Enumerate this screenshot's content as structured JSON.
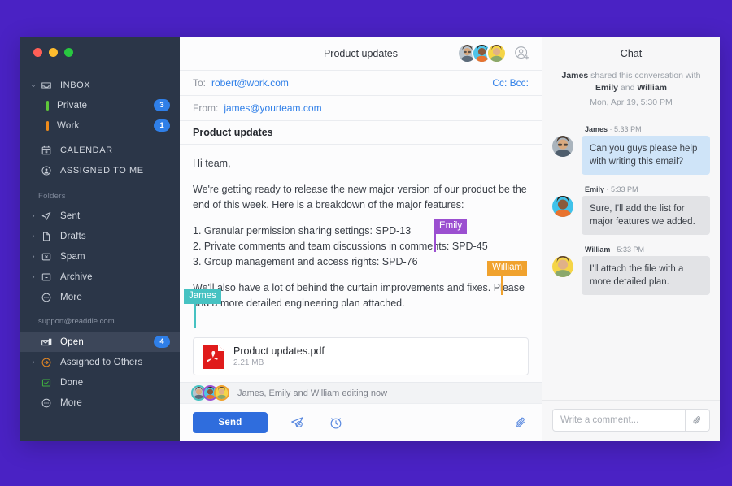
{
  "app": {
    "background_color": "#4a22c4"
  },
  "sidebar": {
    "traffic_lights": [
      "close",
      "minimize",
      "maximize"
    ],
    "inbox": {
      "label": "INBOX",
      "icon": "inbox-icon"
    },
    "inbox_children": [
      {
        "label": "Private",
        "badge": "3",
        "color": "#5fc73a"
      },
      {
        "label": "Work",
        "badge": "1",
        "color": "#ef8b1b"
      }
    ],
    "top_items": [
      {
        "label": "CALENDAR",
        "icon": "calendar-icon"
      },
      {
        "label": "ASSIGNED TO ME",
        "icon": "assigned-person-icon"
      }
    ],
    "folders_title": "Folders",
    "folders": [
      {
        "label": "Sent",
        "icon": "paper-plane-icon",
        "expandable": true
      },
      {
        "label": "Drafts",
        "icon": "document-icon",
        "expandable": true
      },
      {
        "label": "Spam",
        "icon": "spam-icon",
        "expandable": true
      },
      {
        "label": "Archive",
        "icon": "archive-box-icon",
        "expandable": true
      },
      {
        "label": "More",
        "icon": "ellipsis-circle-icon",
        "expandable": false
      }
    ],
    "account": "support@readdle.com",
    "account_items": [
      {
        "label": "Open",
        "icon": "open-envelope-icon",
        "badge": "4",
        "active": true,
        "expandable": false
      },
      {
        "label": "Assigned to Others",
        "icon": "assigned-others-icon",
        "badge": "",
        "active": false,
        "expandable": true
      },
      {
        "label": "Done",
        "icon": "done-check-icon",
        "badge": "",
        "active": false,
        "expandable": false
      },
      {
        "label": "More",
        "icon": "ellipsis-circle-icon",
        "badge": "",
        "active": false,
        "expandable": false
      }
    ]
  },
  "mail": {
    "title": "Product updates",
    "add_person_icon": "add-person-icon",
    "to_label": "To:",
    "to_value": "robert@work.com",
    "cc_bcc": "Cc: Bcc:",
    "from_label": "From:",
    "from_value": "james@yourteam.com",
    "subject": "Product updates",
    "body": {
      "greeting": "Hi team,",
      "paragraph1": "We're getting ready to release the new major version of our product be the end of this week. Here is a breakdown of the major features:",
      "list": [
        "1. Granular permission sharing settings: SPD-13",
        "2. Private comments and team discussions in comments: SPD-45",
        "3. Group management and access rights: SPD-76"
      ],
      "paragraph2": "We'll also have a lot of behind the curtain improvements and fixes. Please find a more detailed engineering plan attached."
    },
    "cursors": [
      {
        "name": "Emily",
        "color": "#9b4fd0"
      },
      {
        "name": "William",
        "color": "#f0a22e"
      },
      {
        "name": "James",
        "color": "#46c2c2"
      }
    ],
    "attachment": {
      "name": "Product updates.pdf",
      "size": "2.21 MB",
      "icon": "pdf-file-icon"
    },
    "editing_status": "James, Emily and William editing now",
    "toolbar": {
      "send_label": "Send",
      "send_later_icon": "send-later-icon",
      "snooze_icon": "snooze-clock-icon",
      "attach_icon": "paperclip-icon"
    }
  },
  "chat": {
    "title": "Chat",
    "intro_prefix": "James",
    "intro_mid": " shared this conversation with ",
    "intro_b": "Emily",
    "intro_and": " and ",
    "intro_c": "William",
    "intro_date": "Mon, Apr 19, 5:30 PM",
    "messages": [
      {
        "author": "James",
        "time": "5:33 PM",
        "text": "Can you guys please help with writing this email?",
        "style": "blue"
      },
      {
        "author": "Emily",
        "time": "5:33 PM",
        "text": "Sure, I'll add the list for major features we added.",
        "style": "grey"
      },
      {
        "author": "William",
        "time": "5:33 PM",
        "text": "I'll attach the file with a more detailed plan.",
        "style": "grey"
      }
    ],
    "input_placeholder": "Write a comment...",
    "input_value": "",
    "attach_icon": "paperclip-icon"
  }
}
